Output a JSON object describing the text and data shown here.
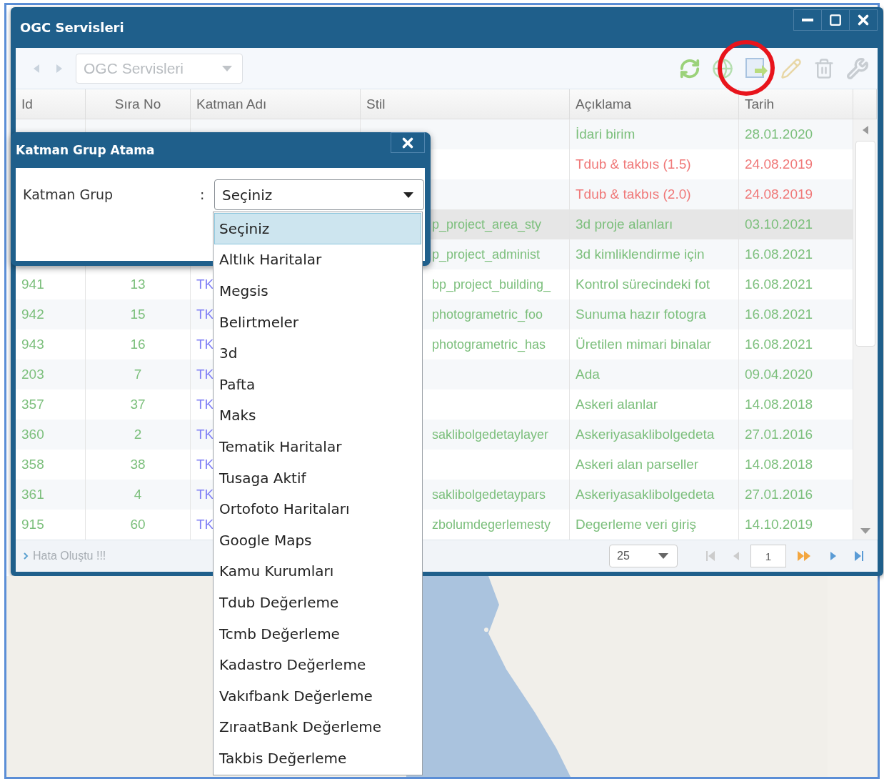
{
  "window": {
    "title": "OGC Servisleri"
  },
  "toolbar": {
    "service_select": "OGC Servisleri"
  },
  "table": {
    "columns": [
      "Id",
      "Sıra No",
      "Katman Adı",
      "Stil",
      "Açıklama",
      "Tarih"
    ],
    "rows": [
      {
        "description": "İdari birim",
        "date": "28.01.2020",
        "color": "#7cbf7c",
        "selected": false
      },
      {
        "description": "Tdub & takbıs (1.5)",
        "date": "24.08.2019",
        "color": "#f07878",
        "selected": false
      },
      {
        "description": "Tdub & takbıs (2.0)",
        "date": "24.08.2019",
        "color": "#f07878",
        "selected": false
      },
      {
        "style": "p_project_area_sty",
        "description": "3d proje alanları",
        "date": "03.10.2021",
        "color": "#7cbf7c",
        "selected": true
      },
      {
        "style": "p_project_administ",
        "description": "3d kimliklendirme için",
        "date": "16.08.2021",
        "color": "#7cbf7c",
        "selected": false
      },
      {
        "id": "941",
        "order": "13",
        "layer": "TK",
        "style": "bp_project_building_",
        "description": "Kontrol sürecindeki fot",
        "date": "16.08.2021",
        "color": "#7cbf7c",
        "selected": false
      },
      {
        "id": "942",
        "order": "15",
        "layer": "TK",
        "style": "photogrametric_foo",
        "description": "Sunuma hazır fotogra",
        "date": "16.08.2021",
        "color": "#7cbf7c",
        "selected": false
      },
      {
        "id": "943",
        "order": "16",
        "layer": "TK",
        "style": "photogrametric_has",
        "description": "Üretilen mimari binalar",
        "date": "16.08.2021",
        "color": "#7cbf7c",
        "selected": false
      },
      {
        "id": "203",
        "order": "7",
        "layer": "TK",
        "description": "Ada",
        "date": "09.04.2020",
        "color": "#7cbf7c",
        "selected": false
      },
      {
        "id": "357",
        "order": "37",
        "layer": "TK",
        "description": "Askeri alanlar",
        "date": "14.08.2018",
        "color": "#7cbf7c",
        "selected": false
      },
      {
        "id": "360",
        "order": "2",
        "layer": "TK",
        "style": "saklibolgedetaylayer",
        "description": "Askeriyasaklibolgedeta",
        "date": "27.01.2016",
        "color": "#7cbf7c",
        "selected": false
      },
      {
        "id": "358",
        "order": "38",
        "layer": "TK",
        "description": "Askeri alan parseller",
        "date": "14.08.2018",
        "color": "#7cbf7c",
        "selected": false
      },
      {
        "id": "361",
        "order": "4",
        "layer": "TK",
        "style": "saklibolgedetaypars",
        "description": "Askeriyasaklibolgedeta",
        "date": "27.01.2016",
        "color": "#7cbf7c",
        "selected": false
      },
      {
        "id": "915",
        "order": "60",
        "layer": "TK",
        "style": "zbolumdegerlemesty",
        "description": "Degerleme veri giriş",
        "date": "14.10.2019",
        "color": "#7cbf7c",
        "selected": false
      }
    ]
  },
  "status_bar": {
    "message": "Hata Oluştu !!!",
    "page_size": "25",
    "page": "1"
  },
  "dialog": {
    "title": "Katman Grup Atama",
    "label": "Katman Grup",
    "separator": ":",
    "value": "Seçiniz",
    "options": [
      {
        "label": "Seçiniz",
        "selected": true
      },
      {
        "label": "Altlık Haritalar",
        "selected": false
      },
      {
        "label": "Megsis",
        "selected": false
      },
      {
        "label": "Belirtmeler",
        "selected": false
      },
      {
        "label": "3d",
        "selected": false
      },
      {
        "label": "Pafta",
        "selected": false
      },
      {
        "label": "Maks",
        "selected": false
      },
      {
        "label": "Tematik Haritalar",
        "selected": false
      },
      {
        "label": "Tusaga Aktif",
        "selected": false
      },
      {
        "label": "Ortofoto Haritaları",
        "selected": false
      },
      {
        "label": "Google Maps",
        "selected": false
      },
      {
        "label": "Kamu Kurumları",
        "selected": false
      },
      {
        "label": "Tdub Değerleme",
        "selected": false
      },
      {
        "label": "Tcmb Değerleme",
        "selected": false
      },
      {
        "label": "Kadastro Değerleme",
        "selected": false
      },
      {
        "label": "Vakıfbank Değerleme",
        "selected": false
      },
      {
        "label": "ZıraatBank Değerleme",
        "selected": false
      },
      {
        "label": "Takbis Değerleme",
        "selected": false
      }
    ]
  }
}
